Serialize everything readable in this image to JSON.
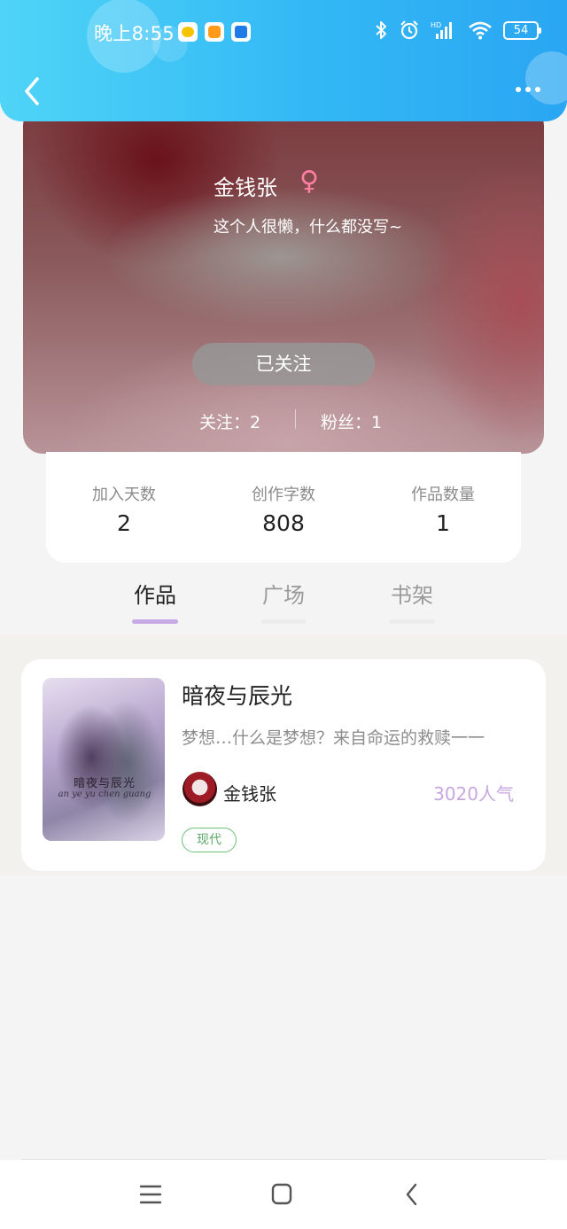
{
  "status_bar": {
    "time": "晚上8:55",
    "battery": "54",
    "app_icons": [
      "chat-app-icon",
      "sms-app-icon",
      "mobile-app-icon"
    ],
    "system_icons": [
      "bluetooth-icon",
      "alarm-icon",
      "hd-signal-icon",
      "wifi-icon",
      "battery-icon"
    ]
  },
  "header": {
    "background_colors": [
      "#4fd4f7",
      "#2aa6f2"
    ],
    "back_icon": "chevron-left-icon",
    "more_icon": "more-dots-icon"
  },
  "profile": {
    "name": "金钱张",
    "gender_symbol": "♀",
    "bio": "这个人很懒，什么都没写~",
    "follow_button": "已关注",
    "following": "关注：2",
    "fans": "粉丝：1"
  },
  "stats": [
    {
      "label": "加入天数",
      "value": "2"
    },
    {
      "label": "创作字数",
      "value": "808"
    },
    {
      "label": "作品数量",
      "value": "1"
    }
  ],
  "tabs": [
    {
      "label": "作品",
      "active": true
    },
    {
      "label": "广场",
      "active": false
    },
    {
      "label": "书架",
      "active": false
    }
  ],
  "works": [
    {
      "title": "暗夜与辰光",
      "description": "梦想…什么是梦想？来自命运的救赎一一",
      "author": "金钱张",
      "popularity": "3020人气",
      "tag": "现代",
      "cover_title": "暗夜与辰光",
      "cover_subtitle": "an ye yu chen guang"
    }
  ],
  "colors": {
    "accent_purple": "#c7a9e6",
    "tag_green": "#5aa867",
    "gender_pink": "#ff7fa3"
  },
  "bottom_nav": [
    "menu-icon",
    "home-icon",
    "back-icon"
  ]
}
